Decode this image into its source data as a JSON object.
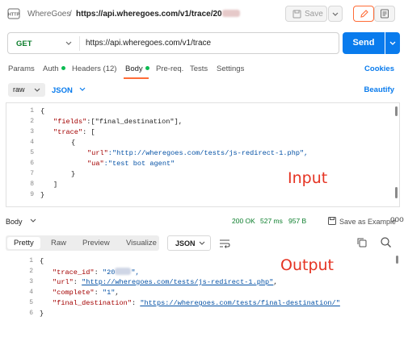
{
  "topbar": {
    "app_name": "WhereGoes",
    "separator": "/",
    "request_url": "https://api.wheregoes.com/v1/trace/20",
    "save_label": "Save"
  },
  "request": {
    "method": "GET",
    "url": "https://api.wheregoes.com/v1/trace",
    "send_label": "Send"
  },
  "tabs": {
    "params": "Params",
    "auth": "Auth",
    "headers": "Headers (12)",
    "body": "Body",
    "prereq": "Pre-req.",
    "tests": "Tests",
    "settings": "Settings",
    "cookies": "Cookies"
  },
  "body_controls": {
    "mode": "raw",
    "format": "JSON",
    "beautify": "Beautify"
  },
  "editor": {
    "line_numbers": [
      "1",
      "2",
      "3",
      "4",
      "5",
      "6",
      "7",
      "8",
      "9"
    ],
    "lines": {
      "l1": "{",
      "l2_key": "\"fields\"",
      "l2_rest": ":[\"final_destination\"],",
      "l3_key": "\"trace\"",
      "l3_rest": ": [",
      "l4": "{",
      "l5_key": "\"url\"",
      "l5_rest": ":\"http://wheregoes.com/tests/js-redirect-1.php\",",
      "l6_key": "\"ua\"",
      "l6_rest": ":\"test bot agent\"",
      "l7": "}",
      "l8": "]",
      "l9": "}"
    },
    "annotation": "Input"
  },
  "response": {
    "label": "Body",
    "status": "200 OK",
    "time": "527 ms",
    "size": "957 B",
    "save_example": "Save as Example",
    "more": "ooo",
    "view_tabs": [
      "Pretty",
      "Raw",
      "Preview",
      "Visualize"
    ],
    "format": "JSON",
    "line_numbers": [
      "1",
      "2",
      "3",
      "4",
      "5",
      "6"
    ],
    "lines": {
      "l1": "{",
      "l2_key": "\"trace_id\"",
      "l2_val": "\"20",
      "l2_end": "\",",
      "l3_key": "\"url\"",
      "l3_val": "\"http://wheregoes.com/tests/js-redirect-1.php\"",
      "l3_end": ",",
      "l4_key": "\"complete\"",
      "l4_val": "\"1\"",
      "l4_end": ",",
      "l5_key": "\"final_destination\"",
      "l5_val": "\"https://wheregoes.com/tests/final-destination/\"",
      "l6": "}"
    },
    "annotation": "Output"
  },
  "colors": {
    "accent_orange": "#ff6c37",
    "send_blue": "#097bed",
    "method_green": "#0c7e2c",
    "annotation_red": "#e53322"
  }
}
